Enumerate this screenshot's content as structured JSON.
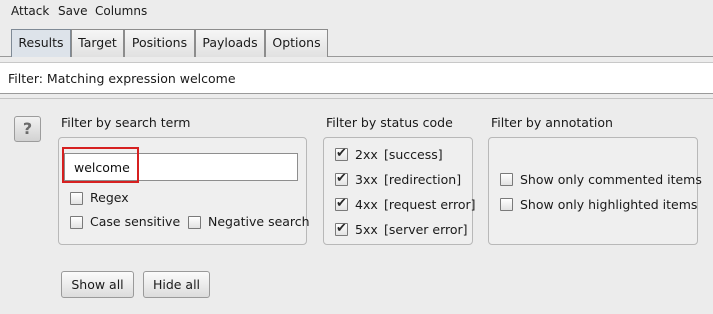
{
  "menu": {
    "items": [
      "Attack",
      "Save",
      "Columns"
    ]
  },
  "tabs": [
    {
      "label": "Results",
      "active": true
    },
    {
      "label": "Target",
      "active": false
    },
    {
      "label": "Positions",
      "active": false
    },
    {
      "label": "Payloads",
      "active": false
    },
    {
      "label": "Options",
      "active": false
    }
  ],
  "filter_bar": {
    "text": "Filter: Matching expression welcome"
  },
  "help": {
    "label": "?"
  },
  "search": {
    "section_label": "Filter by search term",
    "value": "welcome",
    "regex_label": "Regex",
    "case_sensitive_label": "Case sensitive",
    "negative_search_label": "Negative search",
    "regex_checked": false,
    "case_sensitive_checked": false,
    "negative_search_checked": false
  },
  "status": {
    "section_label": "Filter by status code",
    "codes": [
      {
        "code": "2xx",
        "desc": "[success]",
        "checked": true
      },
      {
        "code": "3xx",
        "desc": "[redirection]",
        "checked": true
      },
      {
        "code": "4xx",
        "desc": "[request error]",
        "checked": true
      },
      {
        "code": "5xx",
        "desc": "[server error]",
        "checked": true
      }
    ]
  },
  "annotation": {
    "section_label": "Filter by annotation",
    "commented_label": "Show only commented items",
    "highlighted_label": "Show only highlighted items",
    "commented_checked": false,
    "highlighted_checked": false
  },
  "buttons": {
    "show_all": "Show all",
    "hide_all": "Hide all"
  },
  "colors": {
    "highlight_border": "#d62020",
    "active_tab": "#dde3ea"
  }
}
